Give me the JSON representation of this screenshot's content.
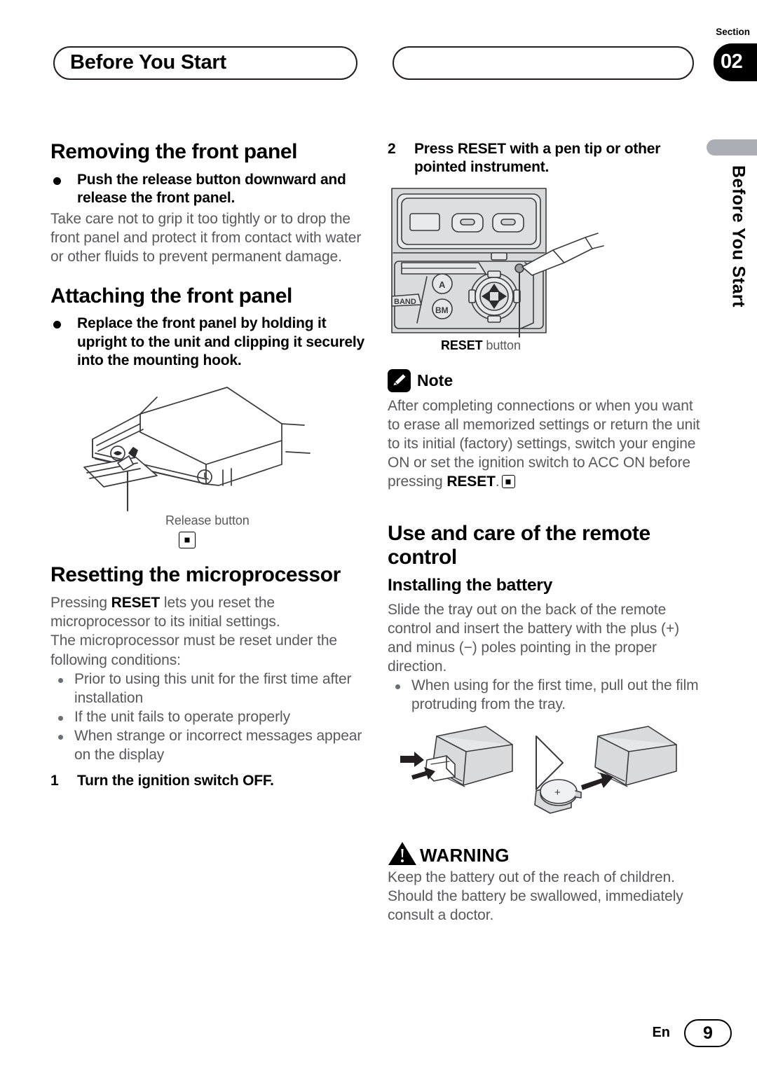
{
  "header": {
    "chapter_title": "Before You Start",
    "section_label": "Section",
    "section_number": "02"
  },
  "side_tab": {
    "text": "Before You Start",
    "color": "#abafb5"
  },
  "left_column": {
    "heading_removing": "Removing the front panel",
    "removing_lead": "Push the release button downward and release the front panel.",
    "removing_body": "Take care not to grip it too tightly or to drop the front panel and protect it from contact with water or other fluids to prevent permanent damage.",
    "heading_attaching": "Attaching the front panel",
    "attaching_lead": "Replace the front panel by holding it upright to the unit and clipping it securely into the mounting hook.",
    "figure_caption": "Release button",
    "heading_resetting": "Resetting the microprocessor",
    "reset_para1_a": "Pressing ",
    "reset_para1_kw": "RESET",
    "reset_para1_b": " lets you reset the microprocessor to its initial settings.",
    "reset_para2": "The microprocessor must be reset under the following conditions:",
    "reset_conditions": [
      "Prior to using this unit for the first time after installation",
      "If the unit fails to operate properly",
      "When strange or incorrect messages appear on the display"
    ],
    "step1_num": "1",
    "step1_text": "Turn the ignition switch OFF."
  },
  "right_column": {
    "step2_num": "2",
    "step2_text": "Press RESET with a pen tip or other pointed instrument.",
    "reset_caption_kw": "RESET",
    "reset_caption_rest": " button",
    "note_label": "Note",
    "note_body_a": "After completing connections or when you want to erase all memorized settings or return the unit to its initial (factory) settings, switch your engine ON or set the ignition switch to ACC ON before pressing ",
    "note_body_kw": "RESET",
    "note_body_b": ".",
    "heading_remote": "Use and care of the remote control",
    "heading_battery": "Installing the battery",
    "battery_body": "Slide the tray out on the back of the remote control and insert the battery with the plus (+) and minus (−) poles pointing in the proper direction.",
    "battery_bullets": [
      "When using for the first time, pull out the film protruding from the tray."
    ],
    "warning_label": "WARNING",
    "warning_body": "Keep the battery out of the reach of children. Should the battery be swallowed, immediately consult a doctor."
  },
  "faceplate_figure": {
    "button_a": "A",
    "button_bm": "BM",
    "button_band": "BAND"
  },
  "footer": {
    "language": "En",
    "page_number": "9"
  }
}
